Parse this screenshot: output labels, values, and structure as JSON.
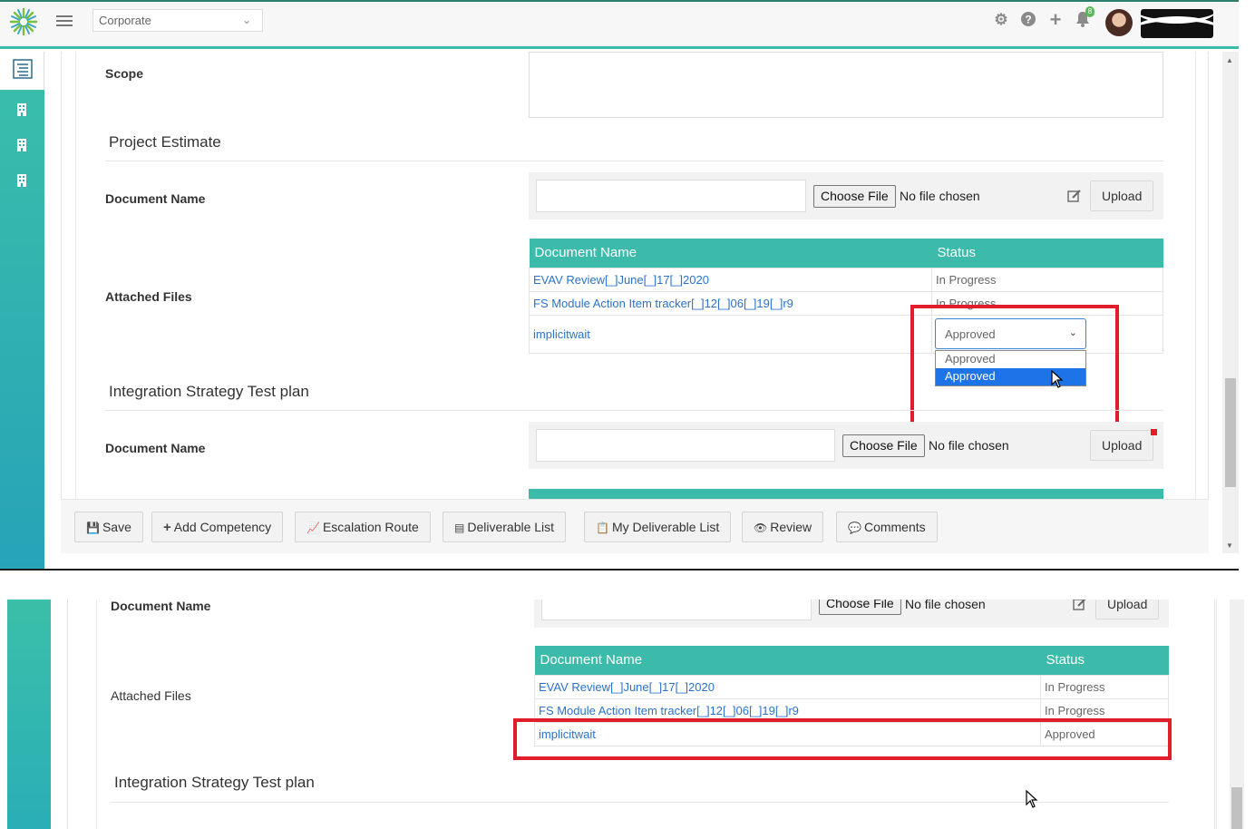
{
  "topbar": {
    "org_select": "Corporate",
    "notification_count": "8",
    "accent_color": "#3dbbaa"
  },
  "sidebar": {
    "items": [
      "list-icon",
      "building-icon",
      "building-icon",
      "building-icon"
    ]
  },
  "scope": {
    "label": "Scope"
  },
  "project_estimate": {
    "title": "Project Estimate",
    "document_name_label": "Document Name",
    "choose_file": "Choose File",
    "no_file": "No file chosen",
    "upload": "Upload",
    "attached_files_label": "Attached Files",
    "table": {
      "headers": [
        "Document Name",
        "Status"
      ],
      "rows": [
        {
          "name": "EVAV Review[_]June[_]17[_]2020",
          "status": "In Progress"
        },
        {
          "name": "FS Module Action Item tracker[_]12[_]06[_]19[_]r9",
          "status": "In Progress"
        },
        {
          "name": "implicitwait",
          "status": "Approved"
        }
      ]
    },
    "status_select": {
      "value": "Approved",
      "options": [
        "Approved",
        "Approved"
      ],
      "highlighted": 1
    }
  },
  "integration": {
    "title": "Integration Strategy Test plan",
    "document_name_label": "Document Name",
    "choose_file": "Choose File",
    "no_file": "No file chosen",
    "upload": "Upload"
  },
  "toolbar": {
    "save": "Save",
    "add_competency": "Add Competency",
    "escalation_route": "Escalation Route",
    "deliverable_list": "Deliverable List",
    "my_deliverable_list": "My Deliverable List",
    "review": "Review",
    "comments": "Comments"
  },
  "bottom": {
    "document_name_label": "Document Name",
    "choose_file": "Choose File",
    "no_file": "No file chosen",
    "upload": "Upload",
    "attached_files_label": "Attached Files",
    "table": {
      "headers": [
        "Document Name",
        "Status"
      ],
      "rows": [
        {
          "name": "EVAV Review[_]June[_]17[_]2020",
          "status": "In Progress"
        },
        {
          "name": "FS Module Action Item tracker[_]12[_]06[_]19[_]r9",
          "status": "In Progress"
        },
        {
          "name": "implicitwait",
          "status": "Approved"
        }
      ]
    },
    "integration_title": "Integration Strategy Test plan"
  },
  "colors": {
    "highlight_box": "#e01e2b",
    "link": "#2a73cc",
    "selected_option": "#1e73e8"
  }
}
